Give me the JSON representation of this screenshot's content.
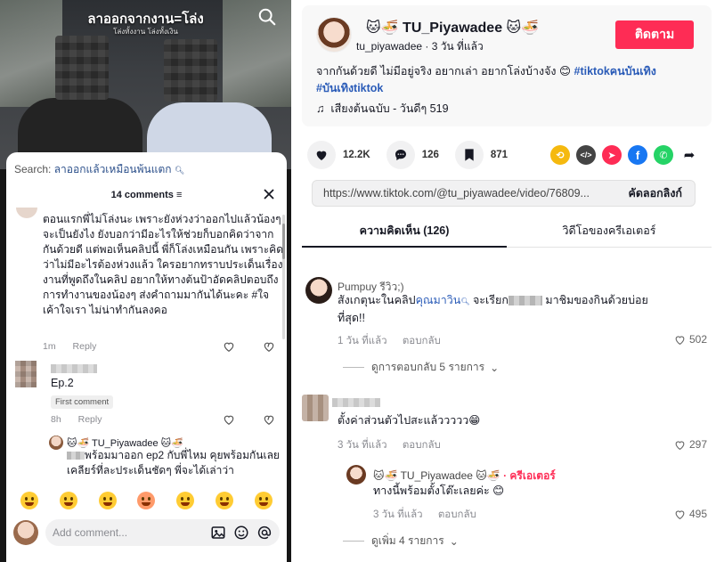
{
  "video": {
    "title": "ลาออกจากงาน=โล่ง",
    "subtitle": "โล่งทั้งงาน โล่งทั้งเงิน"
  },
  "sheet": {
    "search_prefix": "Search:",
    "search_query": "ลาออกแล้วเหมือนพ้นแตก",
    "comment_count": "14 comments",
    "comment1": {
      "text": "ตอนแรกพี่ไม่โล่งนะ เพราะยังห่วงว่าออกไปแล้วน้องๆจะเป็นยังไง ยังบอกว่ามีอะไรให้ช่วยก็บอกคิดว่าจากกันด้วยดี แต่พอเห็นคลิปนี้ พี่ก็โล่งเหมือนกัน เพราะคิดว่าไม่มีอะไรต้องห่วงแล้ว ใครอยากทราบประเด็นเรื่องงานที่พูดถึงในคลิป อยากให้ทางต้นป้าอัดคลิปตอบถึงการทำงานของน้องๆ ส่งคำถามมากันได้นะคะ #ใจเค้าใจเรา ไม่น่าทำกันลงคอ",
      "time": "1m",
      "reply": "Reply"
    },
    "comment2": {
      "text": "Ep.2",
      "badge": "First comment",
      "time": "8h",
      "reply": "Reply"
    },
    "reply1": {
      "name": "🐱🍜 TU_Piyawadee 🐱🍜",
      "text": "พร้อมมาออก ep2 กับพี่ไหม คุยพร้อมกันเลย เคลียร์ที่ละประเด็นชัดๆ พี่จะได้เล่าว่า"
    },
    "input_placeholder": "Add comment..."
  },
  "post": {
    "author_name": "🐱🍜 TU_Piyawadee 🐱🍜",
    "handle": "tu_piyawadee · 3 วัน ที่แล้ว",
    "follow_label": "ติดตาม",
    "desc_text": "จากกันด้วยดี ไม่มีอยู่จริง อยากเล่า อยากโล่งบ้างจัง 😊",
    "hashtag1": "#tiktokคนบันเทิง",
    "hashtag2": "#บันเทิงtiktok",
    "music": "เสียงต้นฉบับ - วันดีๆ 519",
    "likes": "12.2K",
    "comments": "126",
    "saves": "871",
    "url": "https://www.tiktok.com/@tu_piyawadee/video/76809...",
    "copy_label": "คัดลอกลิงก์"
  },
  "tabs": {
    "comments": "ความคิดเห็น (126)",
    "creator_videos": "วิดีโอของครีเอเตอร์"
  },
  "comments": [
    {
      "name": "Pumpuy รีวิว;)",
      "text_before": "สังเกตุนะในคลิป",
      "link": "คุณมาวิน",
      "text_after": " จะเรียก",
      "text_after2": " มาชิมของกินด้วยบ่อยที่สุด!!",
      "time": "1 วัน ที่แล้ว",
      "reply": "ตอบกลับ",
      "likes": "502",
      "expand": "ดูการตอบกลับ 5 รายการ"
    },
    {
      "text": "ตั้งค่าส่วนตัวไปสะแล้ววววว😁",
      "time": "3 วัน ที่แล้ว",
      "reply": "ตอบกลับ",
      "likes": "297"
    }
  ],
  "creator_reply": {
    "name": "🐱🍜 TU_Piyawadee 🐱🍜",
    "creator": "· ครีเอเตอร์",
    "text": "ทางนี้พร้อมตั้งโต๊ะเลยค่ะ 😊",
    "time": "3 วัน ที่แล้ว",
    "reply": "ตอบกลับ",
    "likes": "495",
    "expand": "ดูเพิ่ม 4 รายการ"
  },
  "colors": {
    "accent": "#fe2c55",
    "hashtag": "#2b5cb8"
  }
}
